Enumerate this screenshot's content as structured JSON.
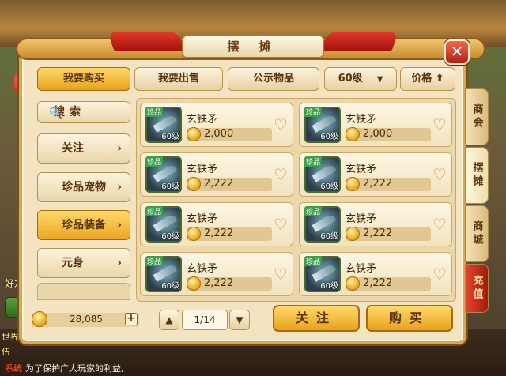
{
  "window": {
    "title": "摆 摊",
    "close": "✕"
  },
  "top_tabs": [
    "我要购买",
    "我要出售",
    "公示物品"
  ],
  "level_filter": "60级",
  "sort_label": "价格 ⬆",
  "sidebar": {
    "search": "搜索",
    "items": [
      "关注",
      "珍品宠物",
      "珍品装备",
      "元身"
    ],
    "active": "珍品装备"
  },
  "items": [
    {
      "name": "玄铁矛",
      "price": "2,000",
      "badge": "珍品",
      "level": "60级"
    },
    {
      "name": "玄铁矛",
      "price": "2,000",
      "badge": "珍品",
      "level": "60级"
    },
    {
      "name": "玄铁矛",
      "price": "2,222",
      "badge": "珍品",
      "level": "60级"
    },
    {
      "name": "玄铁矛",
      "price": "2,222",
      "badge": "珍品",
      "level": "60级"
    },
    {
      "name": "玄铁矛",
      "price": "2,222",
      "badge": "珍品",
      "level": "60级"
    },
    {
      "name": "玄铁矛",
      "price": "2,222",
      "badge": "珍品",
      "level": "60级"
    },
    {
      "name": "玄铁矛",
      "price": "2,222",
      "badge": "珍品",
      "level": "60级"
    },
    {
      "name": "玄铁矛",
      "price": "2,222",
      "badge": "珍品",
      "level": "60级"
    }
  ],
  "side_tabs": [
    "商会",
    "摆摊",
    "商城",
    "充值"
  ],
  "money": "28,085",
  "money_plus": "+",
  "pager": {
    "up": "▲",
    "down": "▼",
    "page": "1/14"
  },
  "actions": {
    "follow": "关注",
    "buy": "购买"
  },
  "background": {
    "friend_label": "好友",
    "chat_world": "世界",
    "chat_wu": "伍",
    "system_tag": "系统",
    "system_msg": "为了保护广大玩家的利益,"
  }
}
